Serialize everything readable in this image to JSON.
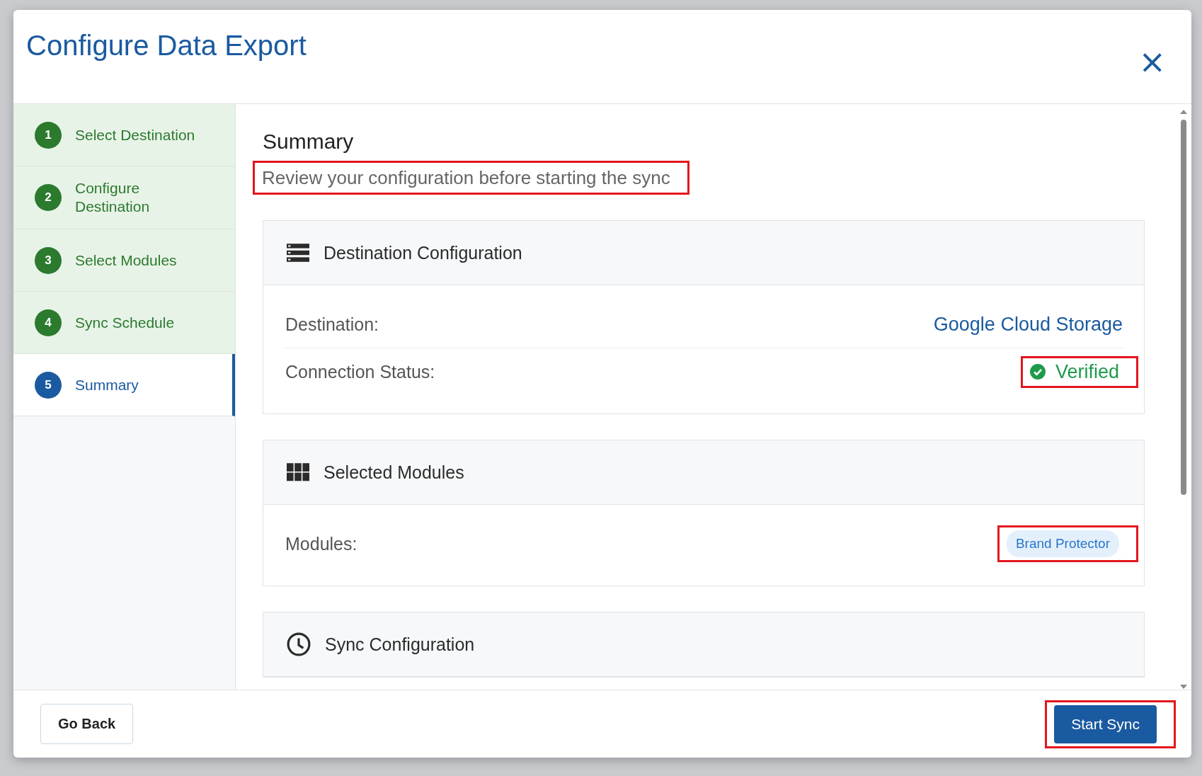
{
  "dialog": {
    "title": "Configure Data Export",
    "close": "×"
  },
  "steps": [
    {
      "number": "1",
      "label": "Select Destination",
      "selected": false
    },
    {
      "number": "2",
      "label": "Configure Destination",
      "selected": false
    },
    {
      "number": "3",
      "label": "Select Modules",
      "selected": false
    },
    {
      "number": "4",
      "label": "Sync Schedule",
      "selected": false
    },
    {
      "number": "5",
      "label": "Summary",
      "selected": true
    }
  ],
  "content": {
    "heading": "Summary",
    "subtitle": {
      "text": "Review your configuration before starting the sync",
      "highlighted": true
    },
    "sections": [
      {
        "title": "Destination Configuration",
        "rows": [
          {
            "label": "Destination:",
            "kind": "link",
            "value": "Google Cloud Storage",
            "highlighted": false
          },
          {
            "label": "Connection Status:",
            "kind": "status",
            "value": "Verified",
            "highlighted": true
          }
        ]
      },
      {
        "title": "Selected Modules",
        "rows": [
          {
            "label": "Modules:",
            "kind": "tag",
            "value": "Brand Protector",
            "highlighted": true
          }
        ]
      },
      {
        "title": "Sync Configuration"
      }
    ]
  },
  "footer": {
    "back_button": {
      "label": "Go Back",
      "highlighted": false
    },
    "start_button": {
      "label": "Start Sync",
      "highlighted": true
    }
  }
}
